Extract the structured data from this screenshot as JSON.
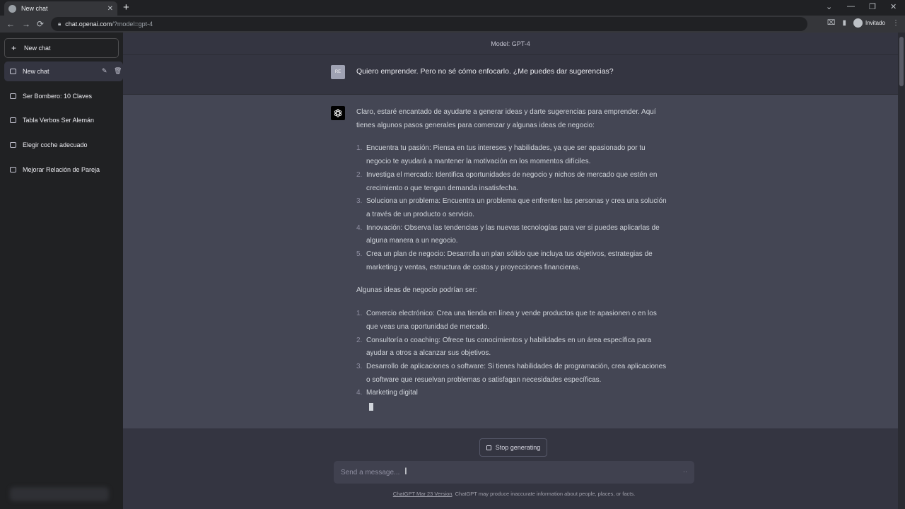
{
  "browser": {
    "tab_title": "New chat",
    "tab_close": "✕",
    "new_tab": "+",
    "back": "←",
    "forward": "→",
    "reload": "⟳",
    "url_host": "chat.openai.com",
    "url_path": "/?model=gpt-4",
    "profile_label": "Invitado",
    "win_controls": [
      "⌄",
      "—",
      "❐",
      "✕"
    ]
  },
  "sidebar": {
    "new_chat_label": "New chat",
    "conversations": [
      {
        "label": "New chat",
        "active": true
      },
      {
        "label": "Ser Bombero: 10 Claves"
      },
      {
        "label": "Tabla Verbos Ser Alemán"
      },
      {
        "label": "Elegir coche adecuado"
      },
      {
        "label": "Mejorar Relación de Pareja"
      }
    ]
  },
  "chat": {
    "model_label": "Model: GPT-4",
    "user_avatar_initials": "RE",
    "user_message": "Quiero emprender. Pero no sé cómo enfocarlo. ¿Me puedes dar sugerencias?",
    "assistant": {
      "intro": "Claro, estaré encantado de ayudarte a generar ideas y darte sugerencias para emprender. Aquí tienes algunos pasos generales para comenzar y algunas ideas de negocio:",
      "steps": [
        {
          "num": "1.",
          "text": "Encuentra tu pasión: Piensa en tus intereses y habilidades, ya que ser apasionado por tu negocio te ayudará a mantener la motivación en los momentos difíciles."
        },
        {
          "num": "2.",
          "text": "Investiga el mercado: Identifica oportunidades de negocio y nichos de mercado que estén en crecimiento o que tengan demanda insatisfecha."
        },
        {
          "num": "3.",
          "text": "Soluciona un problema: Encuentra un problema que enfrenten las personas y crea una solución a través de un producto o servicio."
        },
        {
          "num": "4.",
          "text": "Innovación: Observa las tendencias y las nuevas tecnologías para ver si puedes aplicarlas de alguna manera a un negocio."
        },
        {
          "num": "5.",
          "text": "Crea un plan de negocio: Desarrolla un plan sólido que incluya tus objetivos, estrategias de marketing y ventas, estructura de costos y proyecciones financieras."
        }
      ],
      "ideas_intro": "Algunas ideas de negocio podrían ser:",
      "ideas": [
        {
          "num": "1.",
          "text": "Comercio electrónico: Crea una tienda en línea y vende productos que te apasionen o en los que veas una oportunidad de mercado."
        },
        {
          "num": "2.",
          "text": "Consultoría o coaching: Ofrece tus conocimientos y habilidades en un área específica para ayudar a otros a alcanzar sus objetivos."
        },
        {
          "num": "3.",
          "text": "Desarrollo de aplicaciones o software: Si tienes habilidades de programación, crea aplicaciones o software que resuelvan problemas o satisfagan necesidades específicas."
        },
        {
          "num": "4.",
          "text": "Marketing digital"
        }
      ]
    }
  },
  "composer": {
    "stop_label": "Stop generating",
    "placeholder": "Send a message...",
    "footer_link": "ChatGPT Mar 23 Version",
    "footer_text": ". ChatGPT may produce inaccurate information about people, places, or facts."
  }
}
